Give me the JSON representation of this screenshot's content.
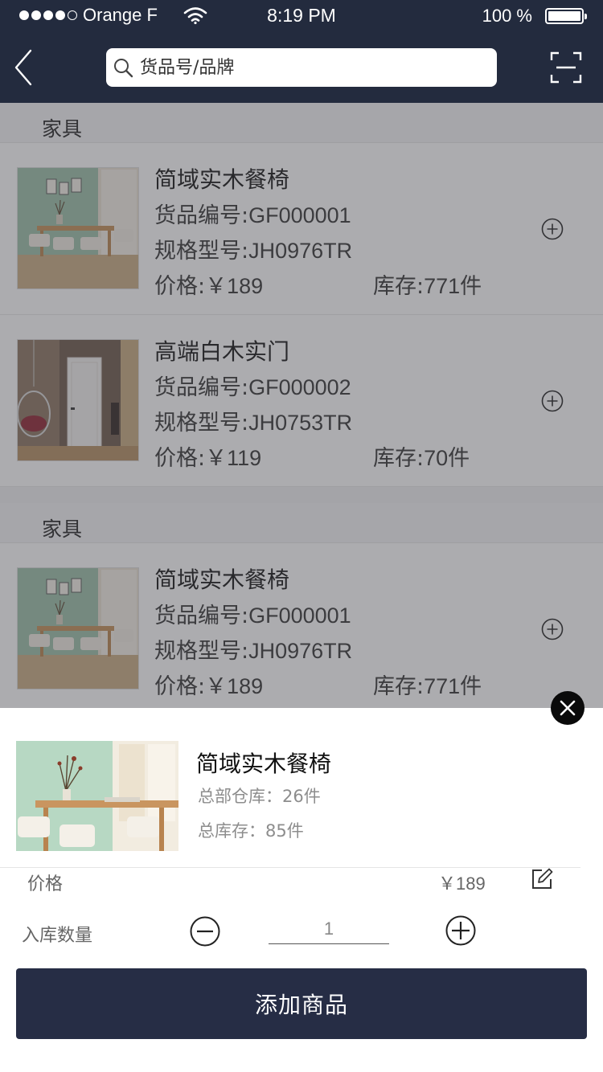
{
  "status_bar": {
    "carrier": "Orange F",
    "time": "8:19 PM",
    "battery": "100 %"
  },
  "nav": {
    "search_placeholder": "货品号/品牌",
    "icons": {
      "back": "chevron-left-icon",
      "search": "search-icon",
      "scan": "scan-icon"
    }
  },
  "list": {
    "sections": [
      {
        "category": "家具",
        "items": [
          {
            "name": "简域实木餐椅",
            "code_label": "货品编号:",
            "code": "GF000001",
            "model_label": "规格型号:",
            "model": "JH0976TR",
            "price_label": "价格:",
            "price": "￥189",
            "stock_label": "库存:",
            "stock": "771",
            "stock_unit": "件"
          },
          {
            "name": "高端白木实门",
            "code_label": "货品编号:",
            "code": "GF000002",
            "model_label": "规格型号:",
            "model": "JH0753TR",
            "price_label": "价格:",
            "price": "￥119",
            "stock_label": "库存:",
            "stock": "70",
            "stock_unit": "件"
          }
        ]
      },
      {
        "category": "家具",
        "items": [
          {
            "name": "简域实木餐椅",
            "code_label": "货品编号:",
            "code": "GF000001",
            "model_label": "规格型号:",
            "model": "JH0976TR",
            "price_label": "价格:",
            "price": "￥189",
            "stock_label": "库存:",
            "stock": "771",
            "stock_unit": "件"
          }
        ]
      }
    ]
  },
  "sheet": {
    "product_name": "简域实木餐椅",
    "hq_stock": "总部仓库：26件",
    "total_stock": "总库存：85件",
    "price_label": "价格",
    "price_value": "￥189",
    "qty_label": "入库数量",
    "qty_value": "1",
    "add_button": "添加商品"
  },
  "colors": {
    "navbar": "#232b3e",
    "add_button": "#262d45",
    "overlay": "rgba(70,72,78,0.45)"
  }
}
